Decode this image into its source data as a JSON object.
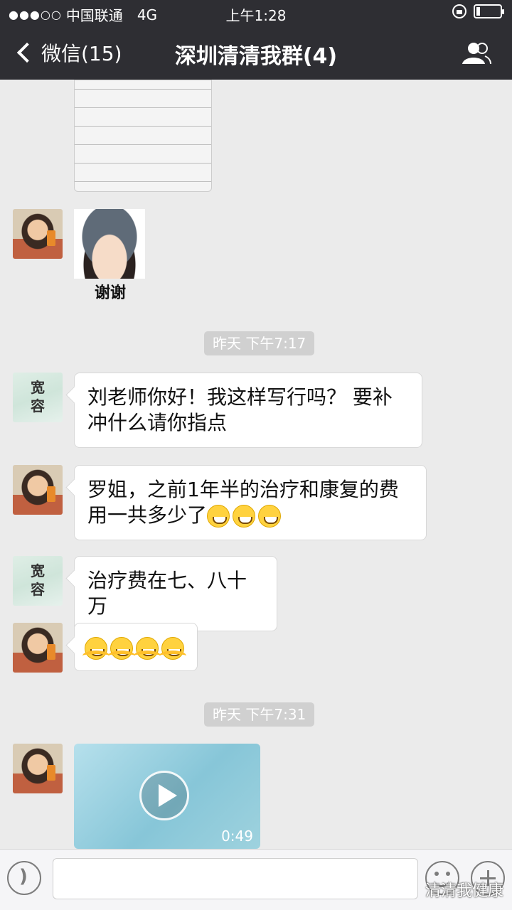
{
  "status_bar": {
    "carrier": "中国联通",
    "network": "4G",
    "time": "上午1:28",
    "battery_level": 0.15
  },
  "nav": {
    "back_label": "微信(15)",
    "title": "深圳清清我群(4)",
    "members_icon": "people-icon"
  },
  "messages": [
    {
      "type": "image",
      "sender": "woman-avatar",
      "content": "handwritten-note-photo"
    },
    {
      "type": "sticker",
      "sender": "woman-avatar",
      "caption": "谢谢"
    },
    {
      "type": "timestamp",
      "text": "昨天 下午7:17"
    },
    {
      "type": "text",
      "sender": "宽容",
      "text": "刘老师你好！我这样写行吗？ 要补冲什么请你指点"
    },
    {
      "type": "text",
      "sender": "woman-avatar",
      "text": "罗姐，之前1年半的治疗和康复的费用一共多少了",
      "emoji": [
        "grin-icon",
        "grin-icon",
        "grin-icon"
      ]
    },
    {
      "type": "text",
      "sender": "宽容",
      "text": "治疗费在七、八十万"
    },
    {
      "type": "emoji-only",
      "sender": "woman-avatar",
      "emoji": [
        "hug-icon",
        "hug-icon",
        "hug-icon",
        "hug-icon"
      ]
    },
    {
      "type": "timestamp",
      "text": "昨天 下午7:31"
    },
    {
      "type": "video",
      "sender": "woman-avatar",
      "duration": "0:49"
    }
  ],
  "avatar_kuanrong_text": [
    "宽",
    "容"
  ],
  "input_bar": {
    "voice_icon": "voice-icon",
    "emoji_icon": "smiley-icon",
    "plus_icon": "plus-icon",
    "watermark": "清清我健康"
  }
}
